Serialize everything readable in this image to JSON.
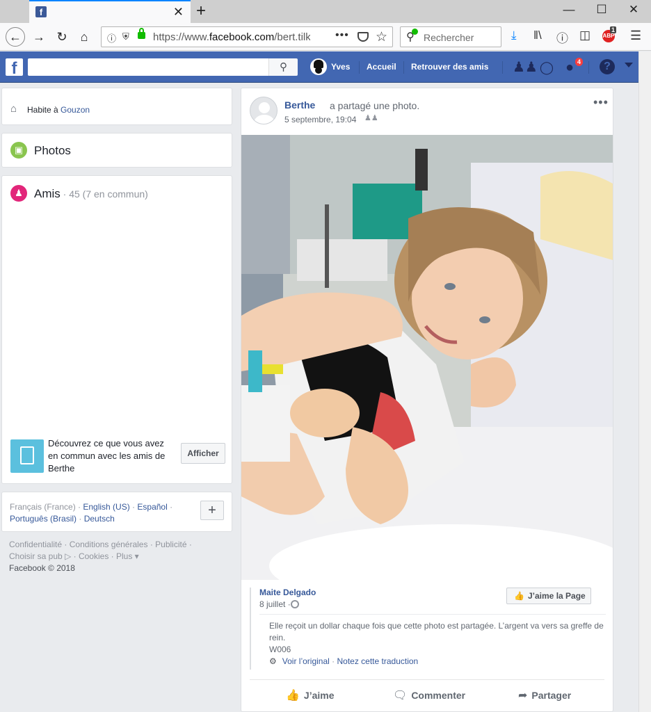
{
  "browser": {
    "tab": {
      "title": "",
      "close_glyph": "✕"
    },
    "new_tab_glyph": "+",
    "window_controls": {
      "minimize": "—",
      "maximize": "☐",
      "close": "✕"
    },
    "url": {
      "prefix": "https://www.",
      "domain": "facebook.com",
      "path": "/bert.tilk"
    },
    "url_more_glyph": "•••",
    "search_placeholder": "Rechercher",
    "abp_label": "ABP",
    "abp_count": "1"
  },
  "fb": {
    "logo": "f",
    "search_value": "",
    "user_name": "Yves",
    "nav_home": "Accueil",
    "nav_find_friends": "Retrouver des amis",
    "notif_count": "4",
    "help": "?"
  },
  "left": {
    "lives_in_label": "Habite à ",
    "lives_in_city": "Gouzon",
    "photos_title": "Photos",
    "friends_title": "Amis",
    "friends_sub": " · 45 (7 en commun)",
    "discover_text": "Découvrez ce que vous avez en commun avec les amis de Berthe",
    "discover_button": "Afficher",
    "languages": {
      "current": "Français (France)",
      "sep": " · ",
      "others": [
        "English (US)",
        "Español",
        "Português (Brasil)",
        "Deutsch"
      ]
    },
    "lang_plus": "+",
    "footer_links": [
      "Confidentialité",
      "Conditions générales",
      "Publicité",
      "Choisir sa pub",
      "Cookies",
      "Plus"
    ],
    "copyright": "Facebook © 2018"
  },
  "post": {
    "author": "Berthe",
    "action": "a partagé une photo.",
    "date": "5 septembre, 19:04",
    "more": "•••",
    "shared": {
      "name": "Maite Delgado",
      "date": "8 juillet ·",
      "like_page": "J’aime la Page",
      "text_line1": "Elle reçoit un dollar chaque fois que cette photo est partagée. L’argent va vers sa greffe de rein.",
      "text_line2": "W006",
      "see_original": "Voir l’original",
      "dot": " · ",
      "rate_translation": "Notez cette traduction"
    },
    "actions": {
      "like": "J’aime",
      "comment": "Commenter",
      "share": "Partager"
    }
  }
}
